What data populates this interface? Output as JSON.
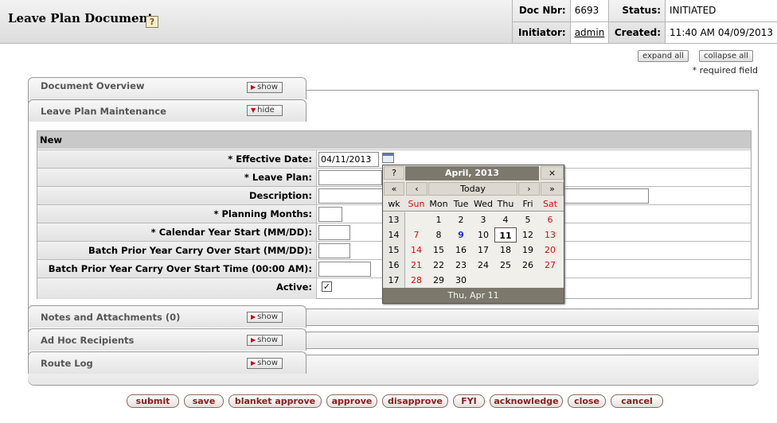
{
  "header": {
    "title": "Leave Plan Document",
    "help": "?",
    "doc_nbr_label": "Doc Nbr:",
    "doc_nbr": "6693",
    "status_label": "Status:",
    "status": "INITIATED",
    "initiator_label": "Initiator:",
    "initiator": "admin",
    "created_label": "Created:",
    "created": "11:40 AM 04/09/2013"
  },
  "toolbar": {
    "expand_all": "expand all",
    "collapse_all": "collapse all",
    "required_note": "* required field"
  },
  "tabs": {
    "document_overview": {
      "label": "Document Overview",
      "button": "show"
    },
    "leave_plan_maintenance": {
      "label": "Leave Plan Maintenance",
      "button": "hide"
    },
    "notes": {
      "label": "Notes and Attachments (0)",
      "button": "show"
    },
    "ad_hoc": {
      "label": "Ad Hoc Recipients",
      "button": "show"
    },
    "route_log": {
      "label": "Route Log",
      "button": "show"
    }
  },
  "form": {
    "section_title": "New",
    "effective_date_label": "* Effective Date:",
    "effective_date_value": "04/11/2013",
    "leave_plan_label": "* Leave Plan:",
    "description_label": "Description:",
    "planning_months_label": "* Planning Months:",
    "calendar_year_start_label": "* Calendar Year Start (MM/DD):",
    "batch_prior_start_label": "Batch Prior Year Carry Over Start (MM/DD):",
    "batch_prior_time_label": "Batch Prior Year Carry Over Start Time (00:00 AM):",
    "active_label": "Active:",
    "active_checked": "✓"
  },
  "calendar": {
    "help": "?",
    "month_title": "April, 2013",
    "close": "×",
    "prev_year": "«",
    "prev_month": "‹",
    "today": "Today",
    "next_month": "›",
    "next_year": "»",
    "day_headers": [
      "wk",
      "Sun",
      "Mon",
      "Tue",
      "Wed",
      "Thu",
      "Fri",
      "Sat"
    ],
    "weeks": [
      {
        "wk": "13",
        "days": [
          "",
          "1",
          "2",
          "3",
          "4",
          "5",
          "6"
        ]
      },
      {
        "wk": "14",
        "days": [
          "7",
          "8",
          "9",
          "10",
          "11",
          "12",
          "13"
        ]
      },
      {
        "wk": "15",
        "days": [
          "14",
          "15",
          "16",
          "17",
          "18",
          "19",
          "20"
        ]
      },
      {
        "wk": "16",
        "days": [
          "21",
          "22",
          "23",
          "24",
          "25",
          "26",
          "27"
        ]
      },
      {
        "wk": "17",
        "days": [
          "28",
          "29",
          "30",
          "",
          "",
          "",
          ""
        ]
      }
    ],
    "selected_day": "11",
    "highlight_day": "9",
    "footer": "Thu, Apr 11"
  },
  "actions": [
    "submit",
    "save",
    "blanket approve",
    "approve",
    "disapprove",
    "FYI",
    "acknowledge",
    "close",
    "cancel"
  ]
}
